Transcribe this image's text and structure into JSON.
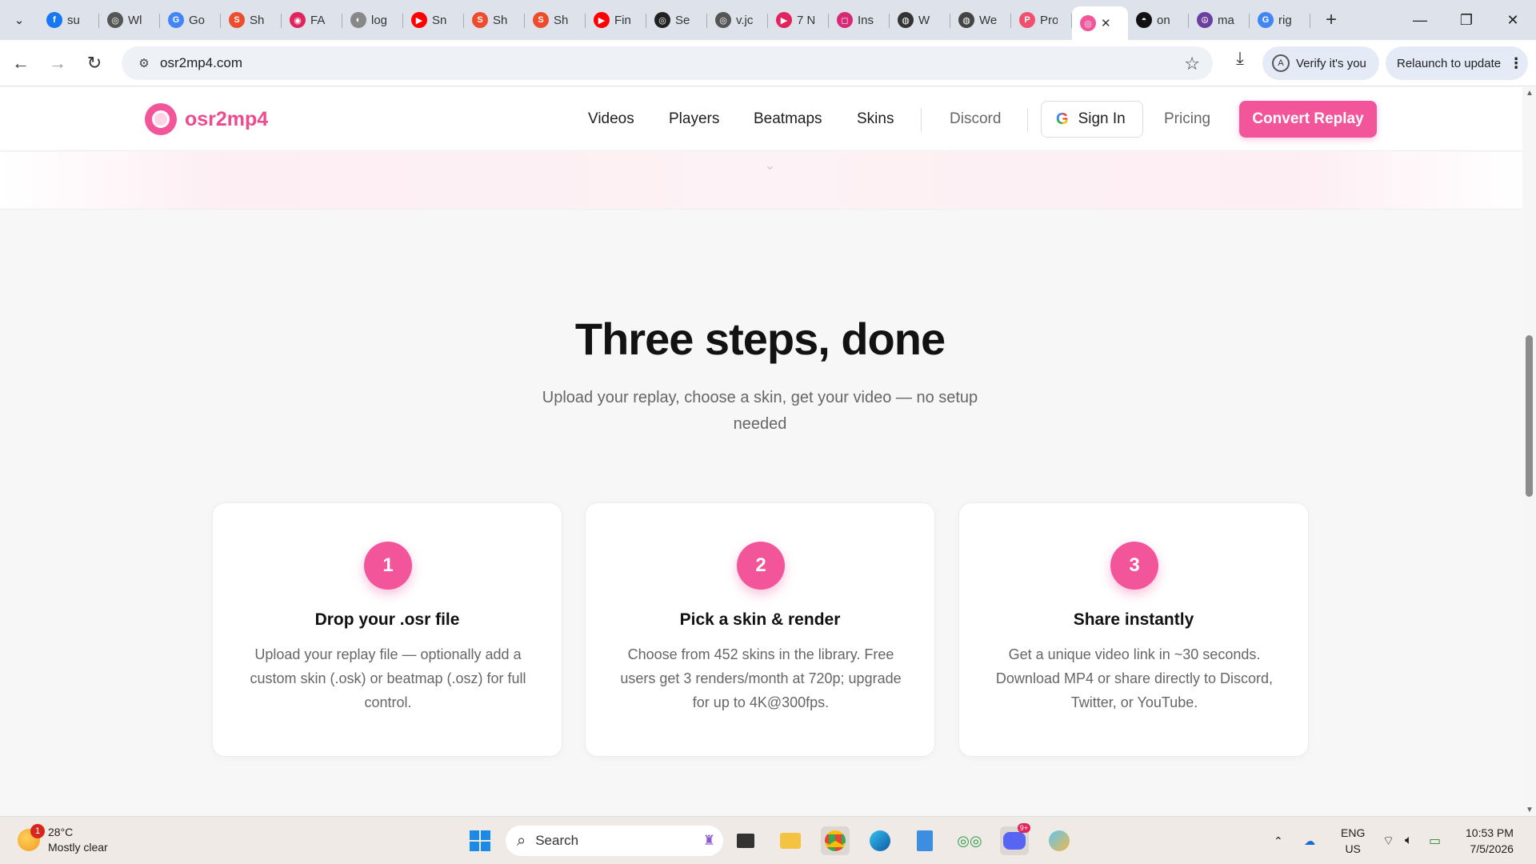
{
  "browser": {
    "tabs": [
      {
        "title": "su",
        "color": "#1877f2",
        "glyph": "f"
      },
      {
        "title": "Wl",
        "color": "#555555",
        "glyph": "◎"
      },
      {
        "title": "Go",
        "color": "#4285f4",
        "glyph": "G"
      },
      {
        "title": "Sh",
        "color": "#ee4d2d",
        "glyph": "S"
      },
      {
        "title": "FA",
        "color": "#e0245e",
        "glyph": "◉"
      },
      {
        "title": "log",
        "color": "#888888",
        "glyph": "◐"
      },
      {
        "title": "Sn",
        "color": "#ff0000",
        "glyph": "▶"
      },
      {
        "title": "Sh",
        "color": "#ee4d2d",
        "glyph": "S"
      },
      {
        "title": "Sh",
        "color": "#ee4d2d",
        "glyph": "S"
      },
      {
        "title": "Fin",
        "color": "#ff0000",
        "glyph": "▶"
      },
      {
        "title": "Se",
        "color": "#222222",
        "glyph": "◎"
      },
      {
        "title": "v.jc",
        "color": "#555555",
        "glyph": "◎"
      },
      {
        "title": "7 N",
        "color": "#e0245e",
        "glyph": "▶"
      },
      {
        "title": "Ins",
        "color": "#d62976",
        "glyph": "◻"
      },
      {
        "title": "W",
        "color": "#333333",
        "glyph": "◍"
      },
      {
        "title": "We",
        "color": "#444444",
        "glyph": "◍"
      },
      {
        "title": "Pro",
        "color": "#f0506e",
        "glyph": "P"
      },
      {
        "title": "",
        "color": "#f2559a",
        "glyph": "◎",
        "active": true
      },
      {
        "title": "on",
        "color": "#111111",
        "glyph": "◓"
      },
      {
        "title": "ma",
        "color": "#6b3fa0",
        "glyph": "☮"
      },
      {
        "title": "rig",
        "color": "#4285f4",
        "glyph": "G"
      }
    ],
    "new_tab": "+",
    "url": "osr2mp4.com",
    "verify_label": "Verify it's you",
    "verify_avatar": "A",
    "relaunch_label": "Relaunch to update"
  },
  "site": {
    "logo_text": "osr2mp4",
    "nav": {
      "videos": "Videos",
      "players": "Players",
      "beatmaps": "Beatmaps",
      "skins": "Skins",
      "discord": "Discord",
      "sign_in": "Sign In",
      "pricing": "Pricing",
      "convert": "Convert Replay"
    }
  },
  "section": {
    "title": "Three steps, done",
    "subtitle": "Upload your replay, choose a skin, get your video — no setup needed",
    "steps": [
      {
        "num": "1",
        "title": "Drop your .osr file",
        "desc": "Upload your replay file — optionally add a custom skin (.osk) or beatmap (.osz) for full control."
      },
      {
        "num": "2",
        "title": "Pick a skin & render",
        "desc": "Choose from 452 skins in the library. Free users get 3 renders/month at 720p; upgrade for up to 4K@300fps."
      },
      {
        "num": "3",
        "title": "Share instantly",
        "desc": "Get a unique video link in ~30 seconds. Download MP4 or share directly to Discord, Twitter, or YouTube."
      }
    ]
  },
  "taskbar": {
    "weather_temp": "28°C",
    "weather_desc": "Mostly clear",
    "weather_badge": "1",
    "search_placeholder": "Search",
    "lang_top": "ENG",
    "lang_bottom": "US",
    "time": "10:53 PM",
    "date": "7/5/2026",
    "discord_badge": "9+"
  },
  "colors": {
    "brand": "#f2559a",
    "tab_strip": "#dee3eb"
  }
}
